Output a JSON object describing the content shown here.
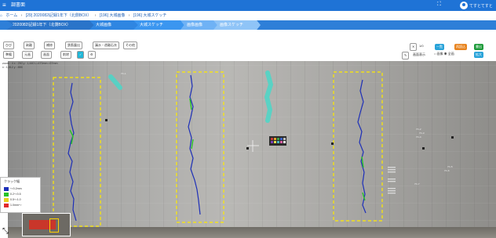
{
  "header": {
    "menu_icon": "hamburger-icon",
    "title": "調書面",
    "expand_icon": "expand-icon",
    "user_icon": "user-avatar-icon",
    "user_name": "てすとてすと"
  },
  "breadcrumb": {
    "items": [
      "ホーム",
      "[29] 2020082l記録1年下（北側BOX）",
      "[196] 大城画像",
      "[196] 大城スケッチ"
    ]
  },
  "steps": {
    "items": [
      "2020082l記録1年下（北側BOX）",
      "大城画像",
      "大城スケッチ",
      "画像画像",
      "画像スケッチ"
    ]
  },
  "toolbar": {
    "row1": [
      "ひび",
      "剥離",
      "補修",
      "鉄筋露出",
      "漏水・遊離石灰",
      "その他"
    ],
    "row2": [
      "準備",
      "元画",
      "画面",
      "削除"
    ],
    "page": "1/0",
    "right_buttons": [
      "一覧",
      "再読込",
      "書出"
    ],
    "display_label": "画面表示",
    "radio_options": [
      "画像",
      "全画",
      "拡大"
    ]
  },
  "info": {
    "lines": [
      "zoom : 4  x : 250  y : 1,440  L=470mm  =57mm",
      "x : 1,812  y : 855"
    ]
  },
  "legend": {
    "title": "クラック幅",
    "rows": [
      {
        "label": "～0.2mm",
        "color": "#1d2fb8"
      },
      {
        "label": "0.2～0.5",
        "color": "#27c227"
      },
      {
        "label": "0.5～1.0",
        "color": "#e8d21d"
      },
      {
        "label": "1.0mm～",
        "color": "#e02b2b"
      }
    ]
  },
  "colors": {
    "header_bg": "#1f73d6",
    "step_bg": "#2e7fd8",
    "region_box": "#ffeb00",
    "crack_primary": "#1d2fb8",
    "crack_secondary": "#27c227",
    "leakage": "#4ad7c8"
  },
  "canvas": {
    "text_marks": [
      "7C-1",
      "7C-2",
      "7C-3",
      "7C-4",
      "7C-5",
      "7C-6",
      "7C-7"
    ]
  },
  "overlay": {
    "collapse_icon": "collapse-arrow-icon"
  }
}
